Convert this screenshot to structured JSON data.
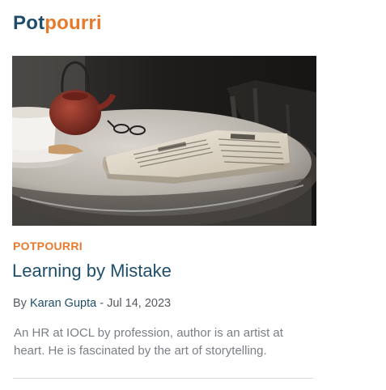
{
  "section": {
    "title_part1": "Pot",
    "title_part2": "pourri"
  },
  "article": {
    "image_alt": "Newspaper and cup of tea on a marble table",
    "category": "POTPOURRI",
    "headline": "Learning by Mistake",
    "byline_prefix": "By",
    "author": "Karan Gupta",
    "date_separator": "-",
    "date": "Jul 14, 2023",
    "excerpt": "An HR at IOCL by profession, author is an artist at heart. He is fascinated by the art of storytelling."
  }
}
